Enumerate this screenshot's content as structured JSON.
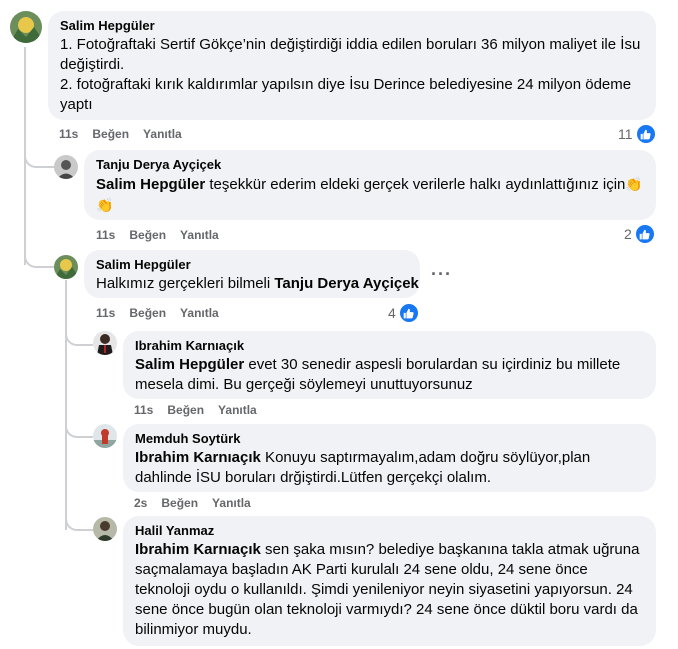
{
  "comments": [
    {
      "author": "Salim Hepgüler",
      "line1": "1. Fotoğraftaki Sertif Gökçe’nin değiştirdiği iddia edilen boruları 36 milyon maliyet ile İsu değiştirdi.",
      "line2": "2. fotoğraftaki kırık kaldırımlar yapılsın diye İsu Derince belediyesine 24 milyon ödeme yaptı",
      "time": "11s",
      "like": "Beğen",
      "reply": "Yanıtla",
      "reactions": "11"
    },
    {
      "author": "Tanju Derya Ayçiçek",
      "mention": "Salim Hepgüler",
      "text": " teşekkür ederim eldeki gerçek verilerle halkı aydınlattığınız için",
      "emoji": "👏",
      "time": "11s",
      "like": "Beğen",
      "reply": "Yanıtla",
      "reactions": "2"
    },
    {
      "author": "Salim Hepgüler",
      "text": "Halkımız gerçekleri bilmeli ",
      "mention": "Tanju Derya Ayçiçek",
      "time": "11s",
      "like": "Beğen",
      "reply": "Yanıtla",
      "reactions": "4",
      "more": "···"
    },
    {
      "author": "Ibrahim Karnıaçık",
      "mention": "Salim Hepgüler",
      "text": " evet 30 senedir aspesli borulardan su içirdiniz bu millete mesela dimi. Bu gerçeği söylemeyi unuttuyorsunuz",
      "time": "11s",
      "like": "Beğen",
      "reply": "Yanıtla"
    },
    {
      "author": "Memduh Soytürk",
      "mention": "Ibrahim Karnıaçık",
      "text": " Konuyu saptırmayalım,adam doğru söylüyor,plan dahlinde İSU boruları drğiştirdi.Lütfen gerçekçi olalım.",
      "time": "2s",
      "like": "Beğen",
      "reply": "Yanıtla"
    },
    {
      "author": "Halil Yanmaz",
      "mention": "Ibrahim Karnıaçık",
      "text": " sen şaka mısın? belediye başkanına takla atmak uğruna saçmalamaya başladın AK Parti kurulalı 24 sene oldu, 24 sene önce teknoloji oydu o kullanıldı. Şimdi yenileniyor neyin siyasetini yapıyorsun. 24 sene önce bugün olan teknoloji varmıydı? 24 sene önce düktil boru vardı da bilinmiyor muydu."
    }
  ],
  "colors": {
    "like_blue": "#1877f2",
    "bubble": "#f0f2f5",
    "meta": "#65676b"
  }
}
